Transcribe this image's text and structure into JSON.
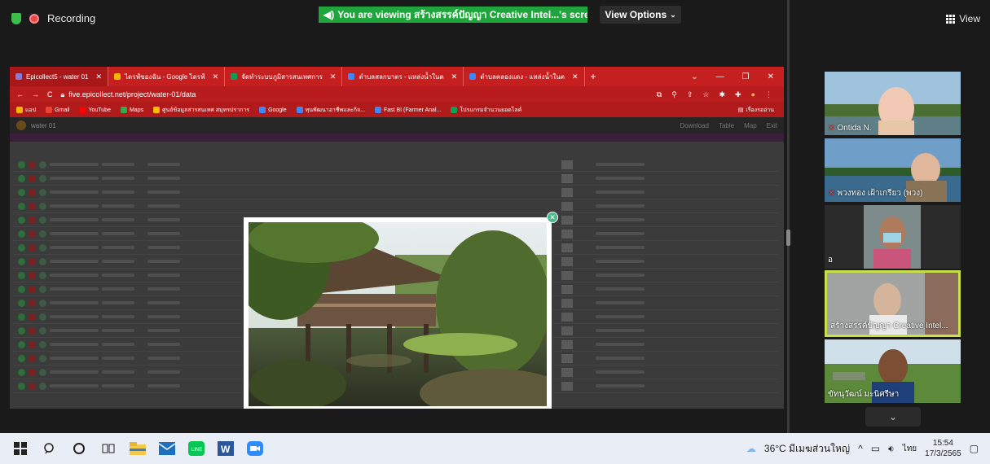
{
  "zoom": {
    "recording_label": "Recording",
    "share_banner": "You are viewing สร้างสรรค์ปัญญา Creative Intel...'s screen",
    "view_options": "View Options",
    "view_button": "View"
  },
  "browser": {
    "tabs": [
      {
        "label": "Epicollect5 - water 01",
        "color": "#8a7bd6"
      },
      {
        "label": "ไดรฟ์ของฉัน - Google ไดรฟ์",
        "color": "#f4b400"
      },
      {
        "label": "จัดทำระบบภูมิสารสนเทศการ",
        "color": "#0f9d58"
      },
      {
        "label": "ตำบลสลกบาตร - แหล่งน้ำในต",
        "color": "#4285f4"
      },
      {
        "label": "ตำบลคลองแดง - แหล่งน้ำในต",
        "color": "#4285f4"
      }
    ],
    "url": "five.epicollect.net/project/water-01/data",
    "bookmarks": [
      {
        "label": "แอป",
        "color": "#f4b400"
      },
      {
        "label": "Gmail",
        "color": "#ea4335"
      },
      {
        "label": "YouTube",
        "color": "#ff0000"
      },
      {
        "label": "Maps",
        "color": "#34a853"
      },
      {
        "label": "ศูนย์ข้อมูลสารสนเทศ สมุทรปราการ",
        "color": "#fbbc05"
      },
      {
        "label": "Google",
        "color": "#4285f4"
      },
      {
        "label": "ทุนพัฒนาอาชีพและกิจ...",
        "color": "#4285f4"
      },
      {
        "label": "Fast BI (Farmer Anal...",
        "color": "#4285f4"
      },
      {
        "label": "โปรแกรมจำนวนยอดไลค์",
        "color": "#0f9d58"
      }
    ],
    "reading_list": "เรื่องรออ่าน",
    "app_title": "water 01",
    "app_actions": [
      "Download",
      "Table",
      "Map",
      "Exit"
    ]
  },
  "participants": [
    {
      "name": "Ontida N.",
      "muted": true
    },
    {
      "name": "พวงทอง เฝ้าเกรียว (พวง)",
      "muted": true
    },
    {
      "name": "อ",
      "muted": false
    },
    {
      "name": "สร้างสรรค์ปัญญา Creative Intel...",
      "muted": false
    },
    {
      "name": "ขัทนุวัฒน์ มะนิศรีษา",
      "muted": false
    }
  ],
  "taskbar": {
    "weather": "36°C มีเมฆส่วนใหญ่",
    "language": "ไทย",
    "time": "15:54",
    "date": "17/3/2565"
  }
}
